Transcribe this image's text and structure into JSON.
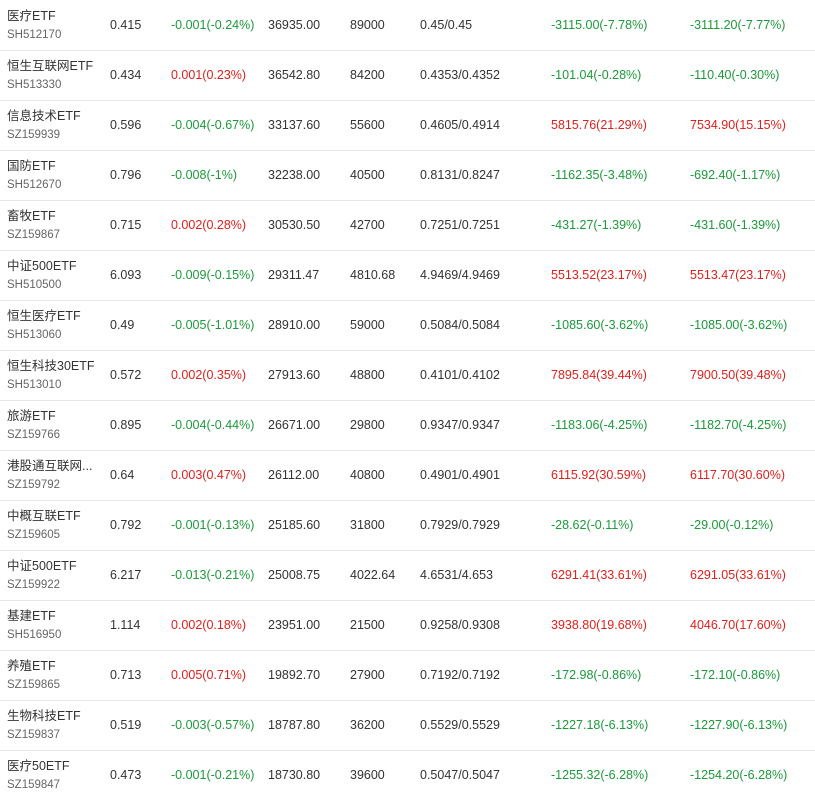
{
  "colors": {
    "up": "#e0201c",
    "down": "#1a9a3a",
    "text": "#333333",
    "code": "#666666",
    "divider": "#e6e6e6"
  },
  "rows": [
    {
      "name": "医疗ETF",
      "code": "SH512170",
      "price": "0.415",
      "change": "-0.001(-0.24%)",
      "dir": "down",
      "vol": "36935.00",
      "shares": "89000",
      "bidask": "0.45/0.45",
      "pl1": "-3115.00(-7.78%)",
      "pl1dir": "down",
      "pl2": "-3111.20(-7.77%)",
      "pl2dir": "down"
    },
    {
      "name": "恒生互联网ETF",
      "code": "SH513330",
      "price": "0.434",
      "change": "0.001(0.23%)",
      "dir": "up",
      "vol": "36542.80",
      "shares": "84200",
      "bidask": "0.4353/0.4352",
      "pl1": "-101.04(-0.28%)",
      "pl1dir": "down",
      "pl2": "-110.40(-0.30%)",
      "pl2dir": "down"
    },
    {
      "name": "信息技术ETF",
      "code": "SZ159939",
      "price": "0.596",
      "change": "-0.004(-0.67%)",
      "dir": "down",
      "vol": "33137.60",
      "shares": "55600",
      "bidask": "0.4605/0.4914",
      "pl1": "5815.76(21.29%)",
      "pl1dir": "up",
      "pl2": "7534.90(15.15%)",
      "pl2dir": "up"
    },
    {
      "name": "国防ETF",
      "code": "SH512670",
      "price": "0.796",
      "change": "-0.008(-1%)",
      "dir": "down",
      "vol": "32238.00",
      "shares": "40500",
      "bidask": "0.8131/0.8247",
      "pl1": "-1162.35(-3.48%)",
      "pl1dir": "down",
      "pl2": "-692.40(-1.17%)",
      "pl2dir": "down"
    },
    {
      "name": "畜牧ETF",
      "code": "SZ159867",
      "price": "0.715",
      "change": "0.002(0.28%)",
      "dir": "up",
      "vol": "30530.50",
      "shares": "42700",
      "bidask": "0.7251/0.7251",
      "pl1": "-431.27(-1.39%)",
      "pl1dir": "down",
      "pl2": "-431.60(-1.39%)",
      "pl2dir": "down"
    },
    {
      "name": "中证500ETF",
      "code": "SH510500",
      "price": "6.093",
      "change": "-0.009(-0.15%)",
      "dir": "down",
      "vol": "29311.47",
      "shares": "4810.68",
      "bidask": "4.9469/4.9469",
      "pl1": "5513.52(23.17%)",
      "pl1dir": "up",
      "pl2": "5513.47(23.17%)",
      "pl2dir": "up"
    },
    {
      "name": "恒生医疗ETF",
      "code": "SH513060",
      "price": "0.49",
      "change": "-0.005(-1.01%)",
      "dir": "down",
      "vol": "28910.00",
      "shares": "59000",
      "bidask": "0.5084/0.5084",
      "pl1": "-1085.60(-3.62%)",
      "pl1dir": "down",
      "pl2": "-1085.00(-3.62%)",
      "pl2dir": "down"
    },
    {
      "name": "恒生科技30ETF",
      "code": "SH513010",
      "price": "0.572",
      "change": "0.002(0.35%)",
      "dir": "up",
      "vol": "27913.60",
      "shares": "48800",
      "bidask": "0.4101/0.4102",
      "pl1": "7895.84(39.44%)",
      "pl1dir": "up",
      "pl2": "7900.50(39.48%)",
      "pl2dir": "up"
    },
    {
      "name": "旅游ETF",
      "code": "SZ159766",
      "price": "0.895",
      "change": "-0.004(-0.44%)",
      "dir": "down",
      "vol": "26671.00",
      "shares": "29800",
      "bidask": "0.9347/0.9347",
      "pl1": "-1183.06(-4.25%)",
      "pl1dir": "down",
      "pl2": "-1182.70(-4.25%)",
      "pl2dir": "down"
    },
    {
      "name": "港股通互联网...",
      "code": "SZ159792",
      "price": "0.64",
      "change": "0.003(0.47%)",
      "dir": "up",
      "vol": "26112.00",
      "shares": "40800",
      "bidask": "0.4901/0.4901",
      "pl1": "6115.92(30.59%)",
      "pl1dir": "up",
      "pl2": "6117.70(30.60%)",
      "pl2dir": "up"
    },
    {
      "name": "中概互联ETF",
      "code": "SZ159605",
      "price": "0.792",
      "change": "-0.001(-0.13%)",
      "dir": "down",
      "vol": "25185.60",
      "shares": "31800",
      "bidask": "0.7929/0.7929",
      "pl1": "-28.62(-0.11%)",
      "pl1dir": "down",
      "pl2": "-29.00(-0.12%)",
      "pl2dir": "down"
    },
    {
      "name": "中证500ETF",
      "code": "SZ159922",
      "price": "6.217",
      "change": "-0.013(-0.21%)",
      "dir": "down",
      "vol": "25008.75",
      "shares": "4022.64",
      "bidask": "4.6531/4.653",
      "pl1": "6291.41(33.61%)",
      "pl1dir": "up",
      "pl2": "6291.05(33.61%)",
      "pl2dir": "up"
    },
    {
      "name": "基建ETF",
      "code": "SH516950",
      "price": "1.114",
      "change": "0.002(0.18%)",
      "dir": "up",
      "vol": "23951.00",
      "shares": "21500",
      "bidask": "0.9258/0.9308",
      "pl1": "3938.80(19.68%)",
      "pl1dir": "up",
      "pl2": "4046.70(17.60%)",
      "pl2dir": "up"
    },
    {
      "name": "养殖ETF",
      "code": "SZ159865",
      "price": "0.713",
      "change": "0.005(0.71%)",
      "dir": "up",
      "vol": "19892.70",
      "shares": "27900",
      "bidask": "0.7192/0.7192",
      "pl1": "-172.98(-0.86%)",
      "pl1dir": "down",
      "pl2": "-172.10(-0.86%)",
      "pl2dir": "down"
    },
    {
      "name": "生物科技ETF",
      "code": "SZ159837",
      "price": "0.519",
      "change": "-0.003(-0.57%)",
      "dir": "down",
      "vol": "18787.80",
      "shares": "36200",
      "bidask": "0.5529/0.5529",
      "pl1": "-1227.18(-6.13%)",
      "pl1dir": "down",
      "pl2": "-1227.90(-6.13%)",
      "pl2dir": "down"
    },
    {
      "name": "医疗50ETF",
      "code": "SZ159847",
      "price": "0.473",
      "change": "-0.001(-0.21%)",
      "dir": "down",
      "vol": "18730.80",
      "shares": "39600",
      "bidask": "0.5047/0.5047",
      "pl1": "-1255.32(-6.28%)",
      "pl1dir": "down",
      "pl2": "-1254.20(-6.28%)",
      "pl2dir": "down"
    }
  ]
}
